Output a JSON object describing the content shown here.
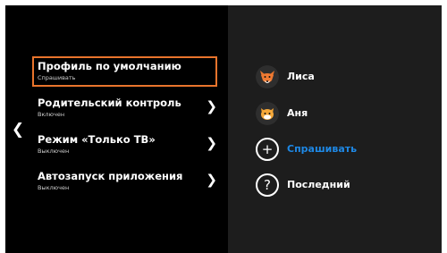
{
  "navigation": {
    "back_icon": "chevron-left-icon"
  },
  "settings": {
    "items": [
      {
        "label": "Профиль по умолчанию",
        "value": "Спрашивать",
        "selected": true,
        "has_chevron": false
      },
      {
        "label": "Родительский контроль",
        "value": "Включен",
        "selected": false,
        "has_chevron": true
      },
      {
        "label": "Режим «Только ТВ»",
        "value": "Выключен",
        "selected": false,
        "has_chevron": true
      },
      {
        "label": "Автозапуск приложения",
        "value": "Выключен",
        "selected": false,
        "has_chevron": true
      }
    ]
  },
  "profiles": {
    "options": [
      {
        "name": "Лиса",
        "icon": "fox-avatar-icon"
      },
      {
        "name": "Аня",
        "icon": "cat-avatar-icon"
      },
      {
        "name": "Спрашивать",
        "icon": "plus-icon",
        "highlighted": true
      },
      {
        "name": "Последний",
        "icon": "question-icon"
      }
    ]
  },
  "colors": {
    "focus_border": "#e8742c",
    "accent_blue": "#1e88e5",
    "panel_dark": "#000000",
    "panel_right": "#1d1d1d"
  }
}
